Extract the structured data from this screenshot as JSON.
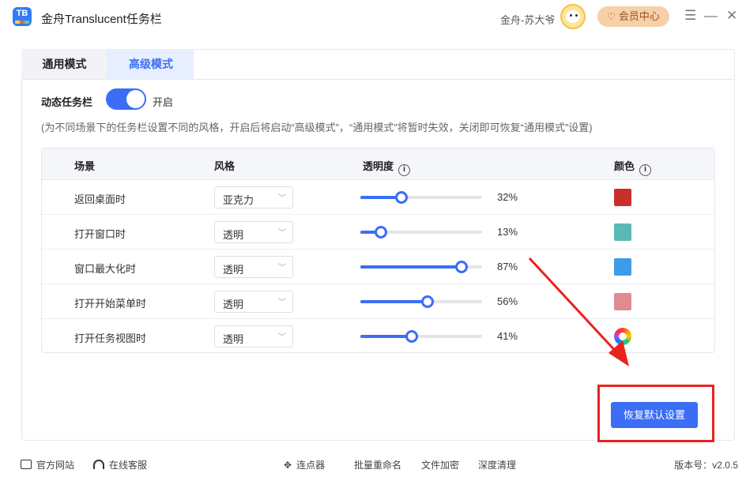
{
  "window": {
    "app_logo_text": "TB",
    "title": "金舟Translucent任务栏",
    "user_name": "金舟-苏大爷",
    "vip_label": "会员中心",
    "controls": {
      "menu": "☰",
      "minimize": "—",
      "close": "✕"
    }
  },
  "tabs": [
    {
      "label": "通用模式",
      "active": false
    },
    {
      "label": "高级模式",
      "active": true
    }
  ],
  "dynamic": {
    "label": "动态任务栏",
    "toggle_on": true,
    "state_label": "开启",
    "hint": "(为不同场景下的任务栏设置不同的风格，开启后将启动“高级模式”，“通用模式”将暂时失效，关闭即可恢复“通用模式”设置)"
  },
  "table": {
    "headers": {
      "scene": "场景",
      "style": "风格",
      "opacity": "透明度",
      "color": "颜色"
    },
    "rows": [
      {
        "scene": "返回桌面时",
        "style": "亚克力",
        "opacity": 32,
        "opacity_label": "32%",
        "color": "#c9302c"
      },
      {
        "scene": "打开窗口时",
        "style": "透明",
        "opacity": 13,
        "opacity_label": "13%",
        "color": "#5ab9b4"
      },
      {
        "scene": "窗口最大化时",
        "style": "透明",
        "opacity": 87,
        "opacity_label": "87%",
        "color": "#3d9be9"
      },
      {
        "scene": "打开开始菜单时",
        "style": "透明",
        "opacity": 56,
        "opacity_label": "56%",
        "color": "#e18a8f"
      },
      {
        "scene": "打开任务视图时",
        "style": "透明",
        "opacity": 41,
        "opacity_label": "41%",
        "color": "rainbow"
      }
    ]
  },
  "reset_label": "恢复默认设置",
  "footer": {
    "website": "官方网站",
    "service": "在线客服",
    "tools": [
      "连点器",
      "批量重命名",
      "文件加密",
      "深度清理"
    ],
    "version": "版本号：v2.0.5"
  },
  "colors": {
    "accent": "#3b6ef5",
    "annotation": "#e8231d",
    "vip_bg": "#f6d0a8"
  }
}
